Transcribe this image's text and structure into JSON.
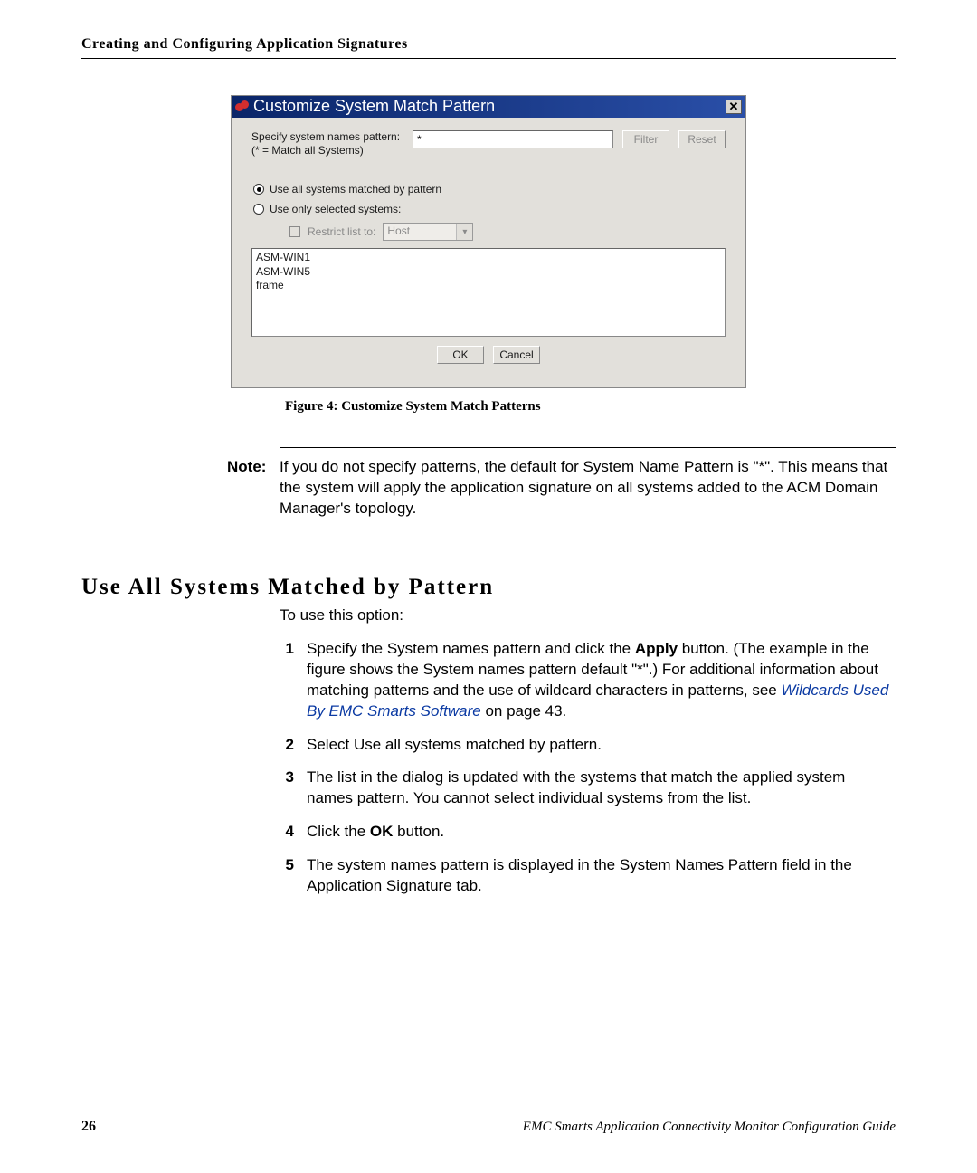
{
  "header_title": "Creating and Configuring Application Signatures",
  "dialog": {
    "title": "Customize System Match Pattern",
    "close_symbol": "✕",
    "pattern_label": "Specify system names pattern:",
    "pattern_label_sub": "(* = Match all Systems)",
    "pattern_value": "*",
    "filter_btn": "Filter",
    "reset_btn": "Reset",
    "radio_all": "Use all systems matched by pattern",
    "radio_sel": "Use only selected systems:",
    "restrict_label": "Restrict list to:",
    "restrict_option": "Host",
    "list_items": [
      "ASM-WIN1",
      "ASM-WIN5",
      "frame"
    ],
    "ok_btn": "OK",
    "cancel_btn": "Cancel"
  },
  "caption_prefix": "Figure 4:",
  "caption_text": " Customize System Match Patterns",
  "note_label": "Note:",
  "note_body": "If you do not specify patterns, the default for System Name Pattern is \"*\". This means that the system will apply the application signature on all systems added to the ACM Domain Manager's topology.",
  "section_title": "Use All Systems Matched by Pattern",
  "intro_line": "To use this option:",
  "steps": {
    "s1a": "Specify the System names pattern and click the ",
    "s1_apply": "Apply",
    "s1b": " button. (The example in the figure shows the System names pattern default \"*\".) For additional information about matching patterns and the use of wildcard characters in patterns, see ",
    "s1_link": "Wildcards Used By EMC Smarts Software",
    "s1c": " on page 43.",
    "s2": "Select Use all systems matched by pattern.",
    "s3": "The list in the dialog is updated with the systems that match the applied system names pattern. You cannot select individual systems from the list.",
    "s4a": "Click the ",
    "s4_ok": "OK",
    "s4b": " button.",
    "s5": "The system names pattern is displayed in the System Names Pattern field in the Application Signature tab."
  },
  "page_number": "26",
  "footer_guide": "EMC Smarts Application Connectivity Monitor Configuration Guide"
}
